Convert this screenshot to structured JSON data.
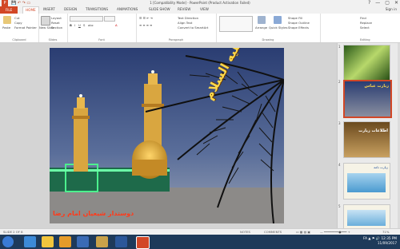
{
  "window": {
    "title": "1 [Compatibility Mode] - PowerPoint (Product Activation Failed)",
    "controls": [
      "?",
      "—",
      "▢",
      "✕"
    ]
  },
  "ribbon_tabs": {
    "file": "FILE",
    "home": "HOME",
    "insert": "INSERT",
    "design": "DESIGN",
    "transitions": "TRANSITIONS",
    "animations": "ANIMATIONS",
    "slide_show": "SLIDE SHOW",
    "review": "REVIEW",
    "view": "VIEW",
    "sign_in": "Sign in"
  },
  "ribbon": {
    "clipboard": {
      "label": "Clipboard",
      "paste": "Paste",
      "cut": "Cut",
      "copy": "Copy",
      "format_painter": "Format Painter"
    },
    "slides": {
      "label": "Slides",
      "new_slide": "New Slide",
      "layout": "Layout",
      "reset": "Reset",
      "section": "Section"
    },
    "font": {
      "label": "Font"
    },
    "paragraph": {
      "label": "Paragraph",
      "text_direction": "Text Direction",
      "align_text": "Align Text",
      "smartart": "Convert to SmartArt"
    },
    "drawing": {
      "label": "Drawing",
      "arrange": "Arrange",
      "quick_styles": "Quick Styles",
      "shape_fill": "Shape Fill",
      "shape_outline": "Shape Outline",
      "shape_effects": "Shape Effects"
    },
    "editing": {
      "label": "Editing",
      "find": "Find",
      "replace": "Replace",
      "select": "Select"
    }
  },
  "slide": {
    "title_text": "زيارت عباس عليه السلام",
    "bottom_text": "دوستدار شیعیان امام رضا"
  },
  "thumbnails": [
    {
      "number": "1"
    },
    {
      "number": "2",
      "selected": true,
      "title": "زيارت عباس"
    },
    {
      "number": "3",
      "title": "اطلاعات زيارت"
    },
    {
      "number": "4",
      "title": "زيارت نامه"
    },
    {
      "number": "5"
    }
  ],
  "status": {
    "slide_info": "SLIDE 2 OF 8",
    "notes": "NOTES",
    "comments": "COMMENTS",
    "zoom": "71%"
  },
  "taskbar": {
    "lang": "FA",
    "time": "12:35 PM",
    "date": "11/09/2017"
  },
  "colors": {
    "accent": "#d24726",
    "taskbar": "#1e3a5a"
  }
}
